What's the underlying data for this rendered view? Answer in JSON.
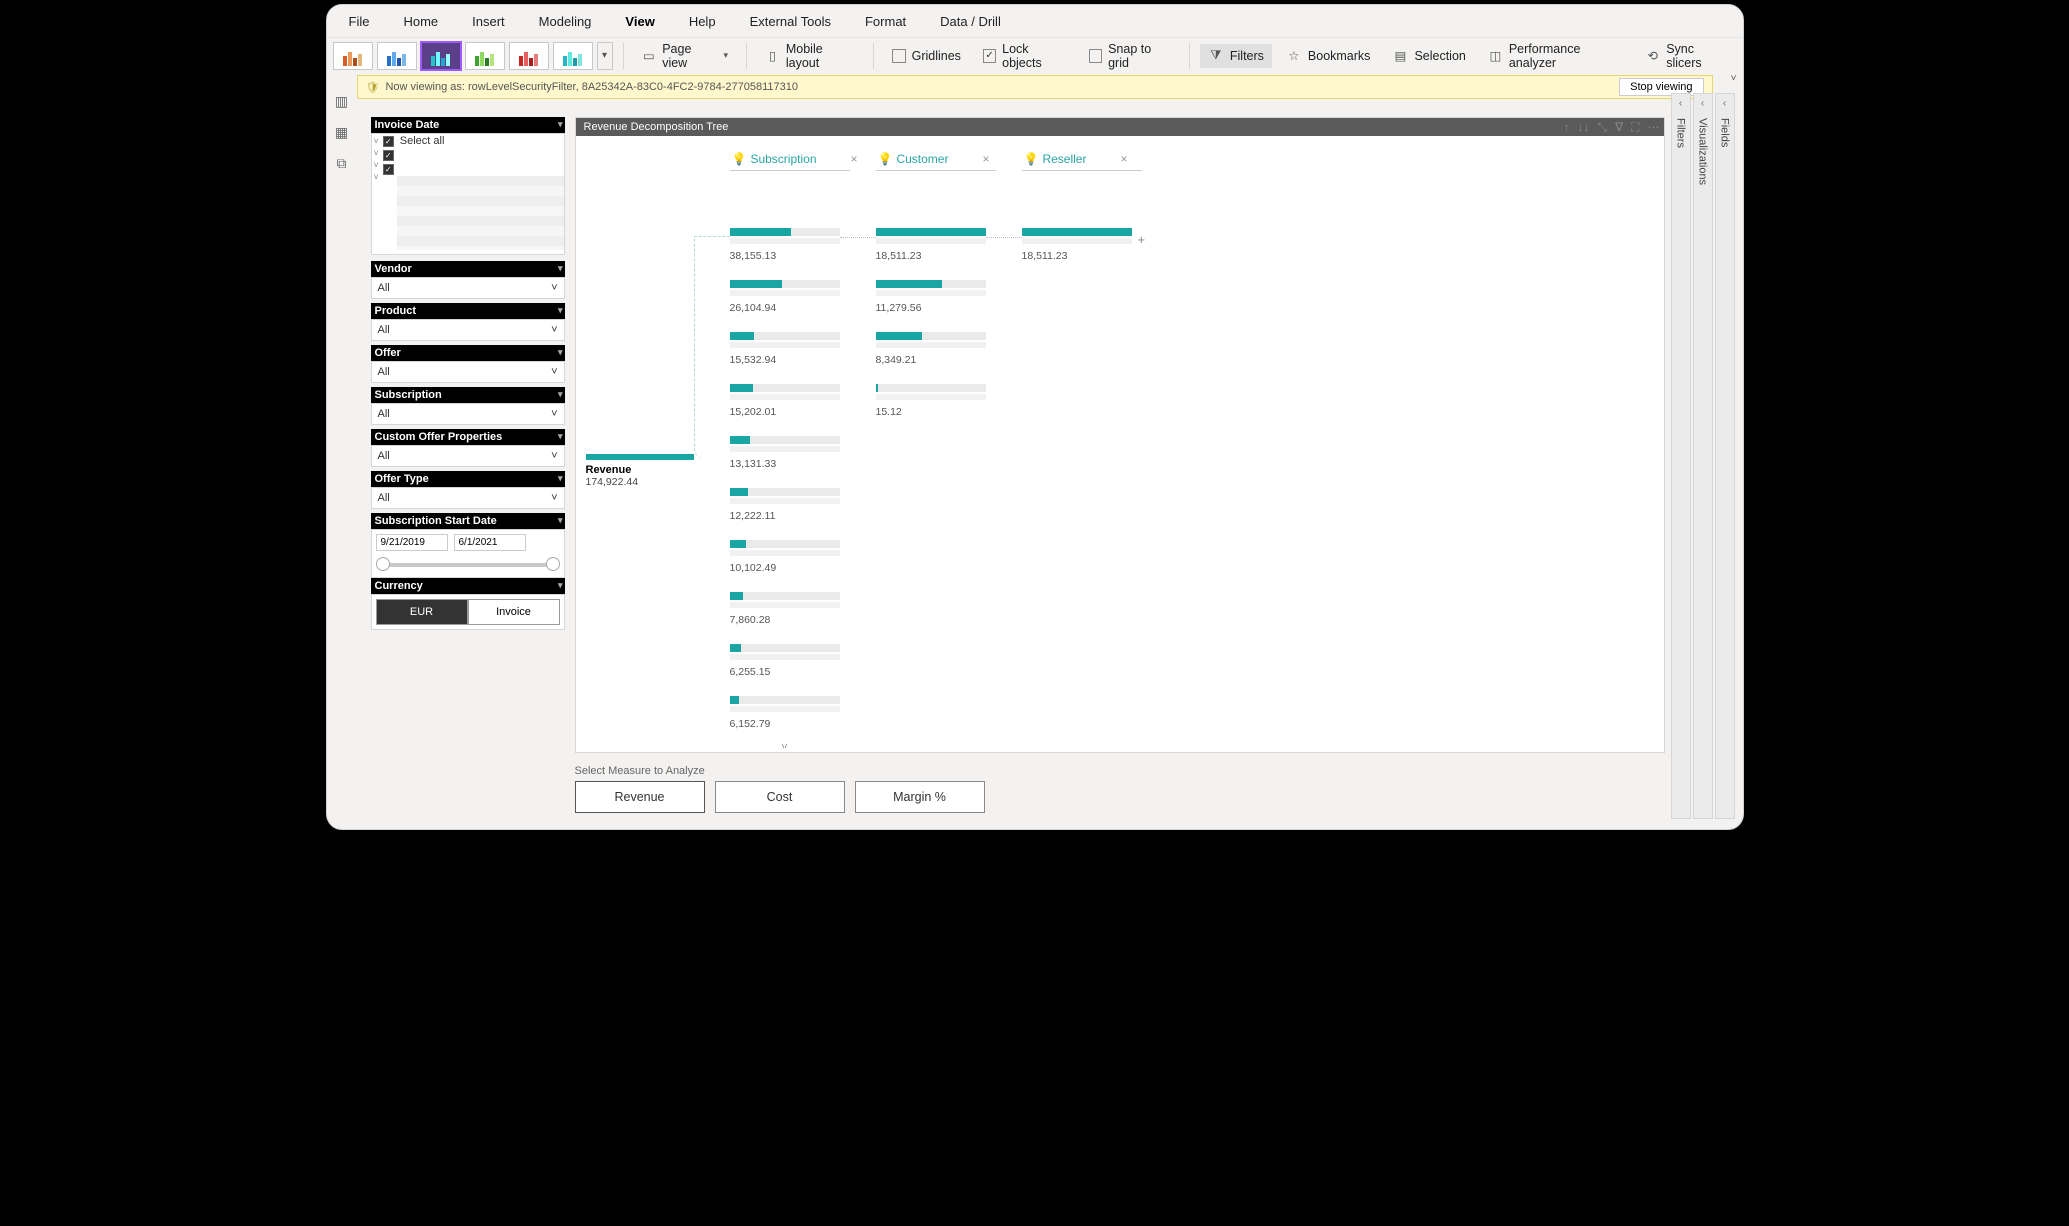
{
  "menus": [
    "File",
    "Home",
    "Insert",
    "Modeling",
    "View",
    "Help",
    "External Tools",
    "Format",
    "Data / Drill"
  ],
  "menu_active": "View",
  "ribbon": {
    "page_view": "Page view",
    "mobile_layout": "Mobile layout",
    "gridlines": "Gridlines",
    "lock_objects": "Lock objects",
    "snap_to_grid": "Snap to grid",
    "filters": "Filters",
    "bookmarks": "Bookmarks",
    "selection": "Selection",
    "perf": "Performance analyzer",
    "sync": "Sync slicers"
  },
  "infobar": {
    "text": "Now viewing as: rowLevelSecurityFilter, 8A25342A-83C0-4FC2-9784-277058117310",
    "stop": "Stop viewing"
  },
  "rails": {
    "filters": "Filters",
    "visualizations": "Visualizations",
    "fields": "Fields"
  },
  "slicers": {
    "invoice_date": {
      "title": "Invoice Date",
      "select_all": "Select all"
    },
    "vendor": {
      "title": "Vendor",
      "value": "All"
    },
    "product": {
      "title": "Product",
      "value": "All"
    },
    "offer": {
      "title": "Offer",
      "value": "All"
    },
    "subscription": {
      "title": "Subscription",
      "value": "All"
    },
    "custom": {
      "title": "Custom Offer Properties",
      "value": "All"
    },
    "offer_type": {
      "title": "Offer Type",
      "value": "All"
    },
    "sub_start": {
      "title": "Subscription Start Date",
      "from": "9/21/2019",
      "to": "6/1/2021"
    },
    "currency": {
      "title": "Currency",
      "opt1": "EUR",
      "opt2": "Invoice"
    }
  },
  "visual": {
    "title": "Revenue Decomposition Tree",
    "root_label": "Revenue",
    "root_value": "174,922.44",
    "levels": [
      "Subscription",
      "Customer",
      "Reseller"
    ],
    "col1": [
      {
        "val": "38,155.13",
        "pct": 56
      },
      {
        "val": "26,104.94",
        "pct": 48
      },
      {
        "val": "15,532.94",
        "pct": 22
      },
      {
        "val": "15,202.01",
        "pct": 21
      },
      {
        "val": "13,131.33",
        "pct": 19
      },
      {
        "val": "12,222.11",
        "pct": 17
      },
      {
        "val": "10,102.49",
        "pct": 15
      },
      {
        "val": "7,860.28",
        "pct": 12
      },
      {
        "val": "6,255.15",
        "pct": 10
      },
      {
        "val": "6,152.79",
        "pct": 9
      }
    ],
    "col2": [
      {
        "val": "18,511.23",
        "pct": 100
      },
      {
        "val": "11,279.56",
        "pct": 60
      },
      {
        "val": "8,349.21",
        "pct": 42
      },
      {
        "val": "15.12",
        "pct": 2
      }
    ],
    "col3": [
      {
        "val": "18,511.23",
        "pct": 100
      }
    ]
  },
  "measure": {
    "label": "Select Measure to Analyze",
    "opts": [
      "Revenue",
      "Cost",
      "Margin %"
    ]
  },
  "chart_data": {
    "type": "bar",
    "title": "Revenue Decomposition Tree",
    "root": {
      "label": "Revenue",
      "value": 174922.44
    },
    "levels": [
      "Subscription",
      "Customer",
      "Reseller"
    ],
    "series": [
      {
        "name": "Subscription",
        "values": [
          38155.13,
          26104.94,
          15532.94,
          15202.01,
          13131.33,
          12222.11,
          10102.49,
          7860.28,
          6255.15,
          6152.79
        ]
      },
      {
        "name": "Customer",
        "values": [
          18511.23,
          11279.56,
          8349.21,
          15.12
        ]
      },
      {
        "name": "Reseller",
        "values": [
          18511.23
        ]
      }
    ],
    "ylabel": "Revenue",
    "xlabel": ""
  }
}
